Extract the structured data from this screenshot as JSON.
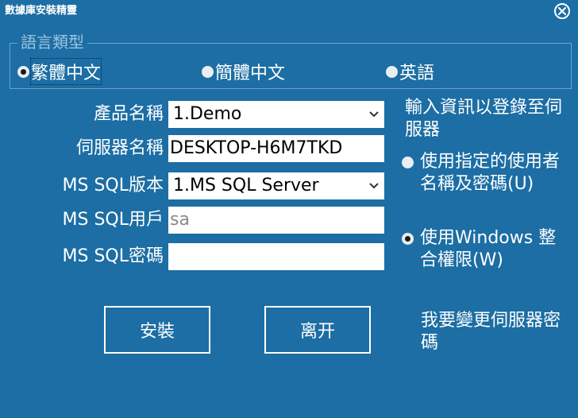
{
  "window": {
    "title": "數據庫安裝精靈"
  },
  "language_group": {
    "legend": "語言類型",
    "options": [
      {
        "label": "繁體中文",
        "checked": true
      },
      {
        "label": "簡體中文",
        "checked": false
      },
      {
        "label": "英語",
        "checked": false
      }
    ]
  },
  "form": {
    "product_label": "產品名稱",
    "product_value": "1.Demo",
    "server_label": "伺服器名稱",
    "server_value": "DESKTOP-H6M7TKD",
    "version_label": "MS SQL版本",
    "version_value": "1.MS SQL Server",
    "user_label": "MS SQL用戶",
    "user_value": "sa",
    "password_label": "MS SQL密碼",
    "password_value": ""
  },
  "auth": {
    "heading": "輸入資訊以登錄至伺服器",
    "option_sql": "使用指定的使用者名稱及密碼(U)",
    "option_windows": "使用Windows 整合權限(W)",
    "selected": "windows",
    "change_password": "我要變更伺服器密碼"
  },
  "buttons": {
    "install": "安裝",
    "exit": "离开"
  },
  "icons": {
    "close": "close-circle-icon",
    "dropdown": "chevron-down-icon"
  },
  "colors": {
    "background": "#1c6ea4",
    "text": "#ffffff"
  }
}
